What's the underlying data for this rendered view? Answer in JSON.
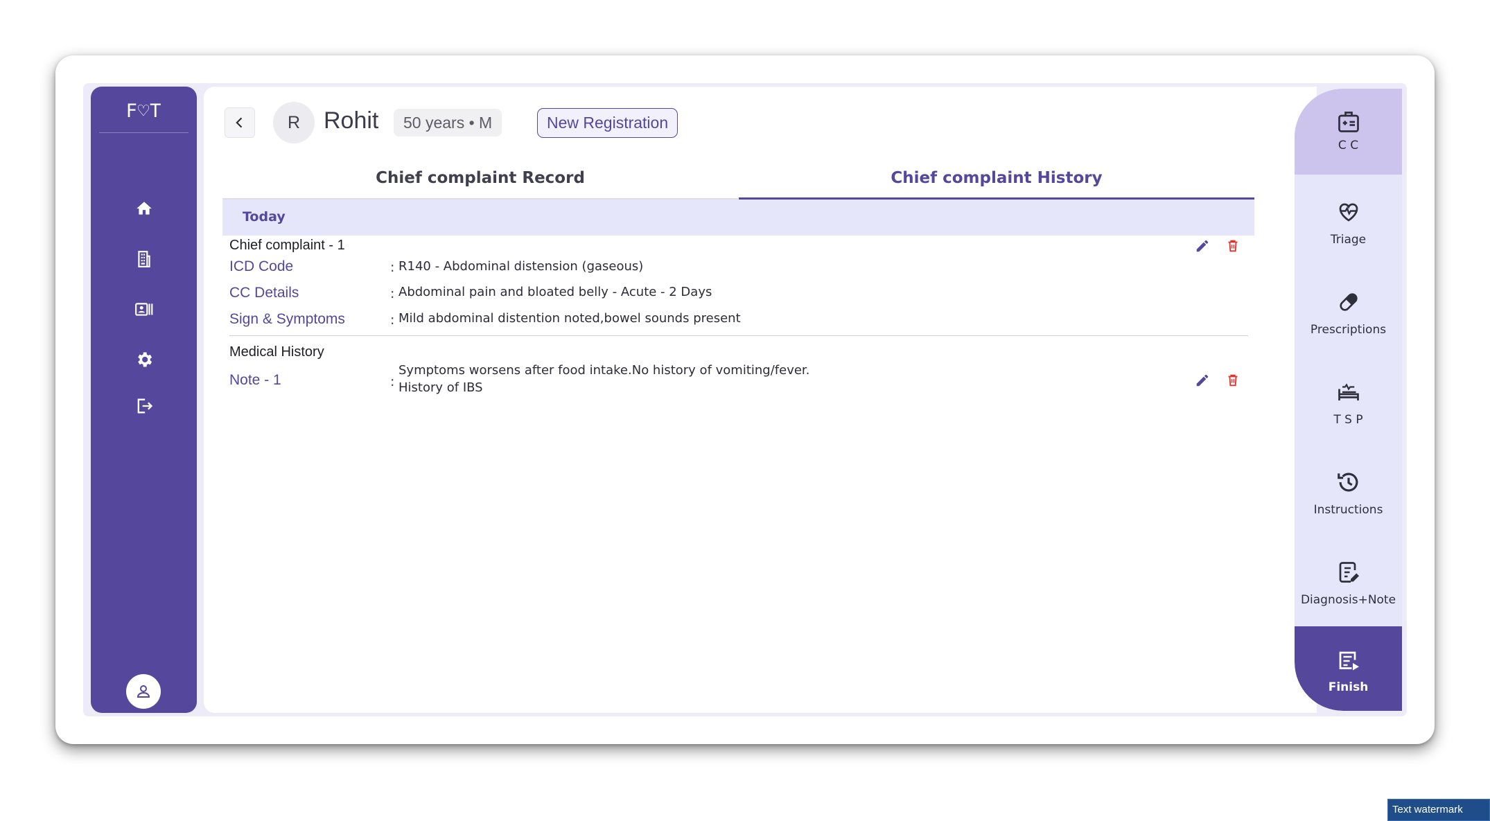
{
  "app": {
    "logo_text": "F♡T"
  },
  "patient": {
    "avatar_initial": "R",
    "name": "Rohit",
    "age_gender": "50 years • M"
  },
  "header": {
    "new_registration_label": "New Registration"
  },
  "tabs": [
    {
      "label": "Chief complaint Record",
      "active": false
    },
    {
      "label": "Chief complaint History",
      "active": true
    }
  ],
  "history": {
    "date_group": "Today",
    "chief_complaint": {
      "title": "Chief complaint - 1",
      "rows": [
        {
          "label": "ICD Code",
          "value": "R140 - Abdominal distension (gaseous)"
        },
        {
          "label": "CC Details",
          "value": "Abdominal pain and bloated belly - Acute - 2 Days"
        },
        {
          "label": "Sign & Symptoms",
          "value": "Mild abdominal distention noted,bowel sounds present"
        }
      ]
    },
    "medical_history": {
      "title": "Medical History",
      "note_label": "Note - 1",
      "note_line1": "Symptoms worsens after food intake.No history of vomiting/fever.",
      "note_line2": "History of IBS"
    },
    "separator": ":"
  },
  "right_nav": [
    {
      "label": "C C",
      "icon": "id-card-plus-icon",
      "active": true
    },
    {
      "label": "Triage",
      "icon": "heart-pulse-icon",
      "active": false
    },
    {
      "label": "Prescriptions",
      "icon": "pill-icon",
      "active": false
    },
    {
      "label": "T S P",
      "icon": "bed-icon",
      "active": false
    },
    {
      "label": "Instructions",
      "icon": "history-clock-icon",
      "active": false
    },
    {
      "label": "Diagnosis+Note",
      "icon": "clipboard-edit-icon",
      "active": false
    },
    {
      "label": "Finish",
      "icon": "finish-icon",
      "active": false
    }
  ],
  "watermark": "Text watermark",
  "colors": {
    "primary": "#54479c",
    "nav_bg": "#e6e6fa",
    "active_nav": "#ccc4ec",
    "delete": "#e0312b"
  }
}
